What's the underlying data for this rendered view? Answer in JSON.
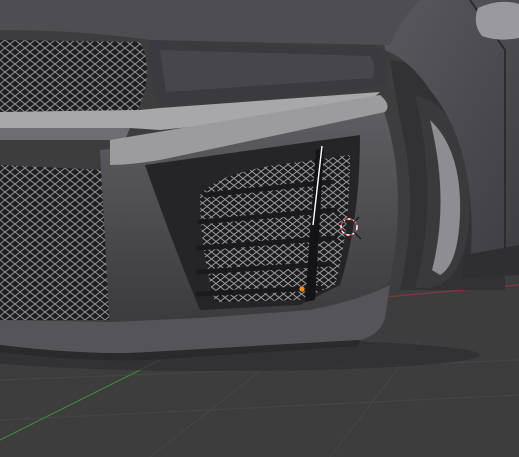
{
  "viewport": {
    "kind": "3d-viewport",
    "shading": "solid",
    "background_color": "#3d3d3d",
    "grid_color": "#474747",
    "axis_x_color": "#7a3a3f",
    "axis_y_color": "#3d7a3f"
  },
  "scene": {
    "object": "car-front-bumper",
    "body_color": "#4a4a4e",
    "highlight_color": "#a3a3a6",
    "grille_color": "#2a2a2c",
    "mesh_color": "#8a8a8a",
    "tire_color": "#303032",
    "slats_count": 5
  },
  "overlays": {
    "cursor_3d": "3d-cursor-icon",
    "origin_point_color": "#ff8a00",
    "selected_edge_color": "#ffffff"
  }
}
